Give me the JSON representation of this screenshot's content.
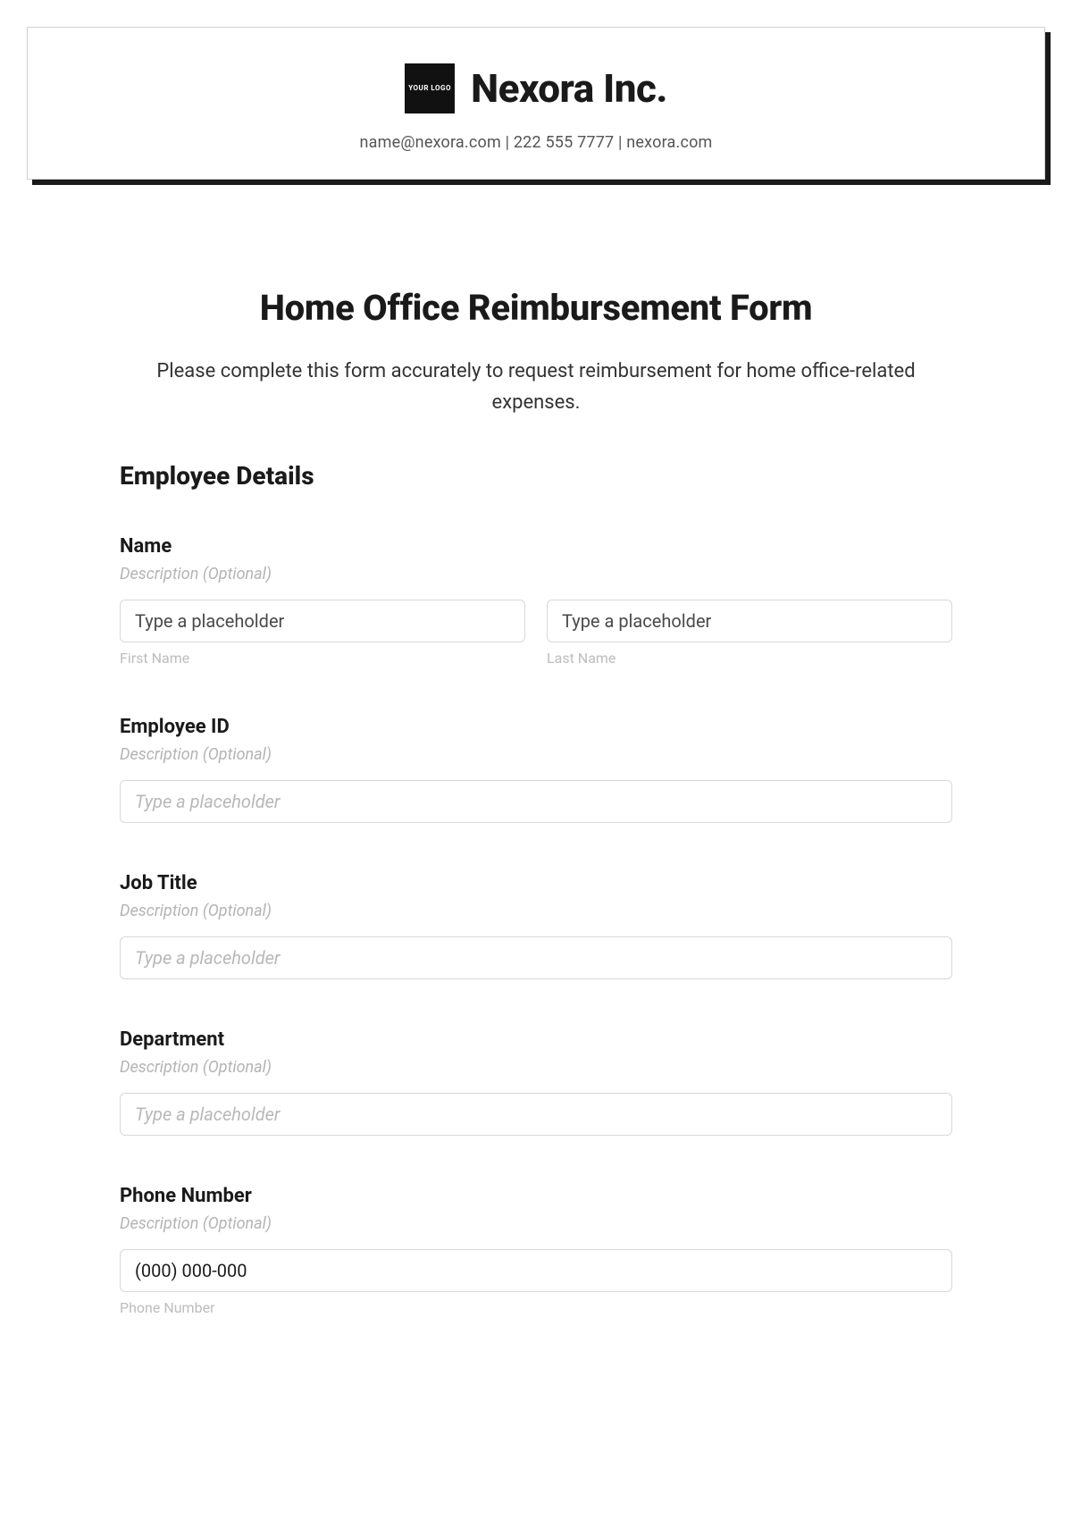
{
  "letterhead": {
    "logo_text": "YOUR\nLOGO",
    "company_name": "Nexora Inc.",
    "contact_line": "name@nexora.com | 222 555 7777 | nexora.com"
  },
  "form": {
    "title": "Home Office Reimbursement Form",
    "intro": "Please complete this form accurately to request reimbursement for home office-related expenses."
  },
  "sections": {
    "employee_details": {
      "heading": "Employee Details"
    }
  },
  "fields": {
    "name": {
      "label": "Name",
      "desc": "Description (Optional)",
      "first_ph": "Type a placeholder",
      "first_sub": "First Name",
      "last_ph": "Type a placeholder",
      "last_sub": "Last Name"
    },
    "employee_id": {
      "label": "Employee ID",
      "desc": "Description (Optional)",
      "ph": "Type a placeholder"
    },
    "job_title": {
      "label": "Job Title",
      "desc": "Description (Optional)",
      "ph": "Type a placeholder"
    },
    "department": {
      "label": "Department",
      "desc": "Description (Optional)",
      "ph": "Type a placeholder"
    },
    "phone": {
      "label": "Phone Number",
      "desc": "Description (Optional)",
      "ph": "(000) 000-000",
      "sub": "Phone Number"
    }
  }
}
